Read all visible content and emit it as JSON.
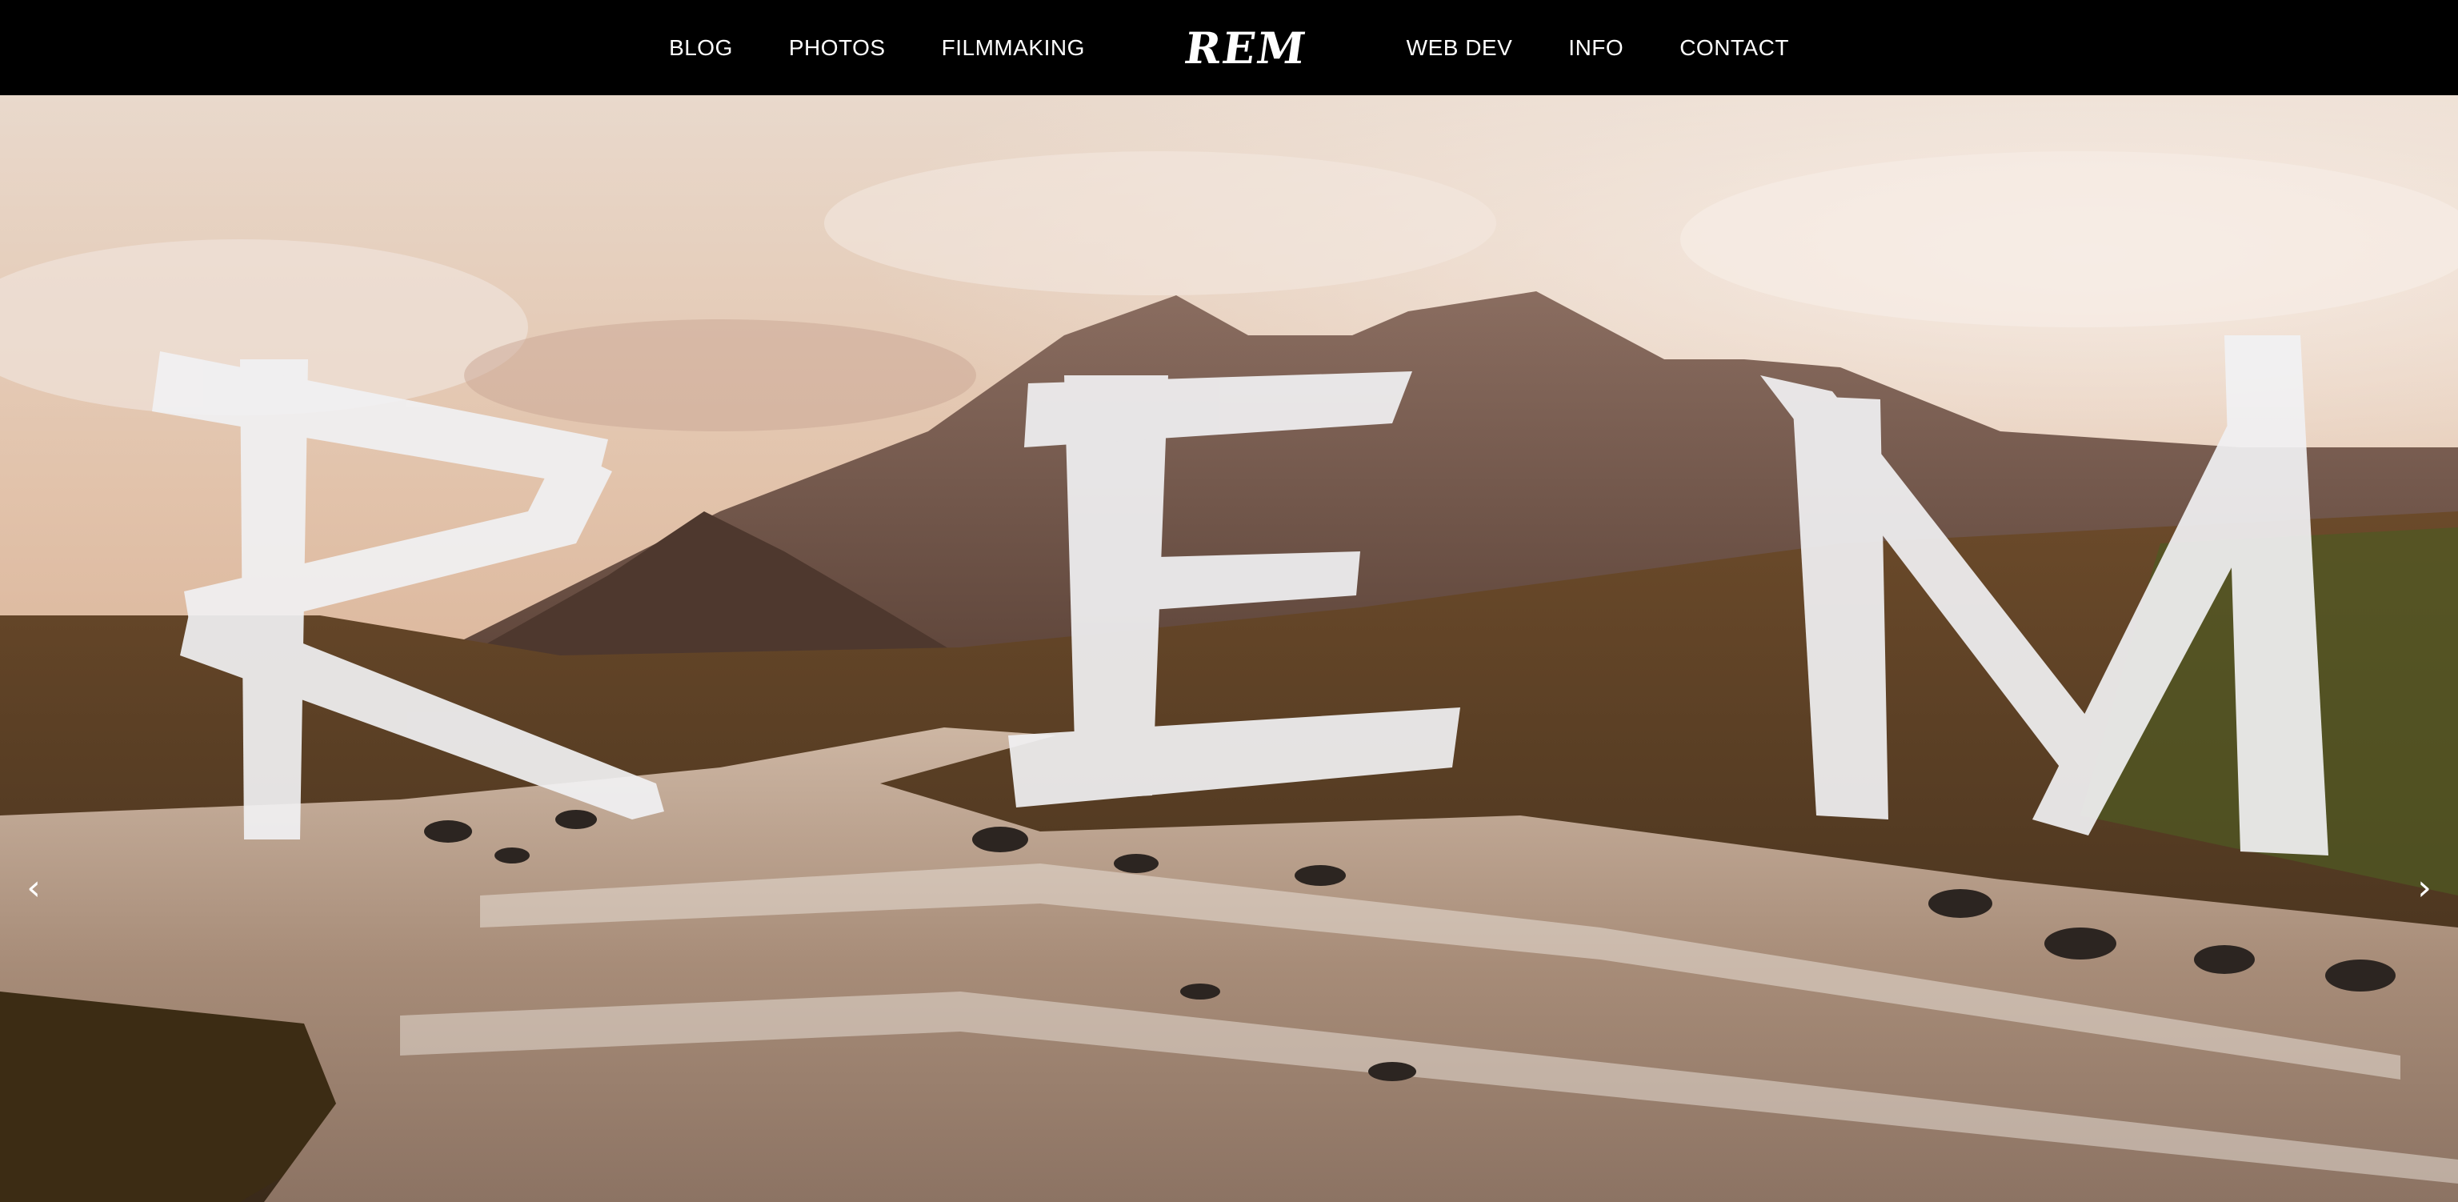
{
  "nav": {
    "left_links": [
      "BLOG",
      "PHOTOS",
      "FILMMAKING"
    ],
    "logo": "REM",
    "right_links": [
      "WEB DEV",
      "INFO",
      "CONTACT"
    ]
  },
  "hero": {
    "prev_label": "‹",
    "next_label": "›"
  },
  "colors": {
    "nav_bg": "#000000",
    "nav_text": "#ffffff",
    "letter_fill": "#f1f1f3"
  },
  "icons": [
    "chevron-left-icon",
    "chevron-right-icon"
  ]
}
